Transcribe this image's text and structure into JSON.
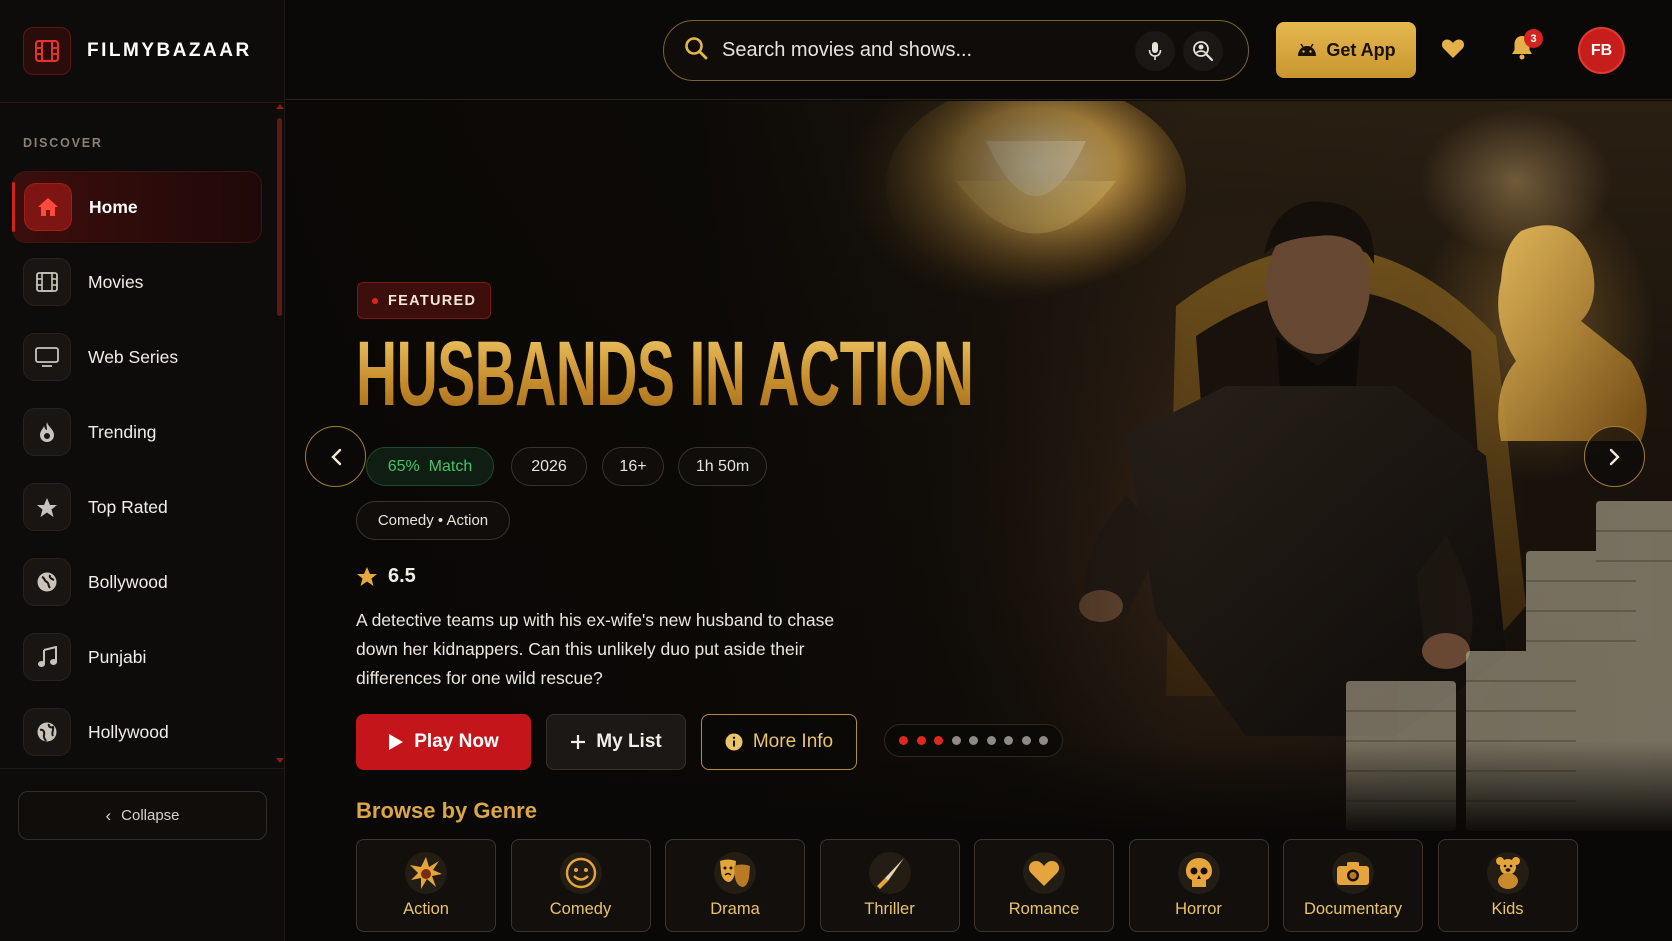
{
  "brand": {
    "name": "FILMYBAZAAR"
  },
  "sidebar": {
    "section_label": "DISCOVER",
    "items": [
      {
        "label": "Home",
        "icon": "home-icon",
        "active": true
      },
      {
        "label": "Movies",
        "icon": "film-icon"
      },
      {
        "label": "Web Series",
        "icon": "tv-icon"
      },
      {
        "label": "Trending",
        "icon": "flame-icon"
      },
      {
        "label": "Top Rated",
        "icon": "star-icon"
      },
      {
        "label": "Bollywood",
        "icon": "globe-icon"
      },
      {
        "label": "Punjabi",
        "icon": "music-icon"
      },
      {
        "label": "Hollywood",
        "icon": "globe-icon"
      }
    ],
    "collapse_label": "Collapse"
  },
  "header": {
    "search_placeholder": "Search movies and shows...",
    "get_app_label": "Get App",
    "notification_count": "3",
    "avatar_initials": "FB"
  },
  "hero": {
    "badge": "FEATURED",
    "title": "HUSBANDS IN ACTION",
    "match_percent": "65%",
    "match_label": "Match",
    "year": "2026",
    "age_rating": "16+",
    "duration": "1h 50m",
    "genres": "Comedy • Action",
    "rating": "6.5",
    "description": "A detective teams up with his ex-wife's new husband to chase down her kidnappers. Can this unlikely duo put aside their differences for one wild rescue?",
    "play_label": "Play Now",
    "list_label": "My List",
    "info_label": "More Info",
    "slides_total": 9,
    "slides_active": [
      0,
      1,
      2
    ]
  },
  "browse": {
    "title": "Browse by Genre",
    "genres": [
      {
        "label": "Action",
        "icon": "explosion-icon"
      },
      {
        "label": "Comedy",
        "icon": "smiley-icon"
      },
      {
        "label": "Drama",
        "icon": "theater-masks-icon"
      },
      {
        "label": "Thriller",
        "icon": "knife-icon"
      },
      {
        "label": "Romance",
        "icon": "heart-icon"
      },
      {
        "label": "Horror",
        "icon": "skull-icon"
      },
      {
        "label": "Documentary",
        "icon": "camera-icon"
      },
      {
        "label": "Kids",
        "icon": "teddy-bear-icon"
      }
    ]
  },
  "colors": {
    "accent_red": "#c4161a",
    "accent_gold": "#dba646",
    "match_green": "#43c46a"
  }
}
